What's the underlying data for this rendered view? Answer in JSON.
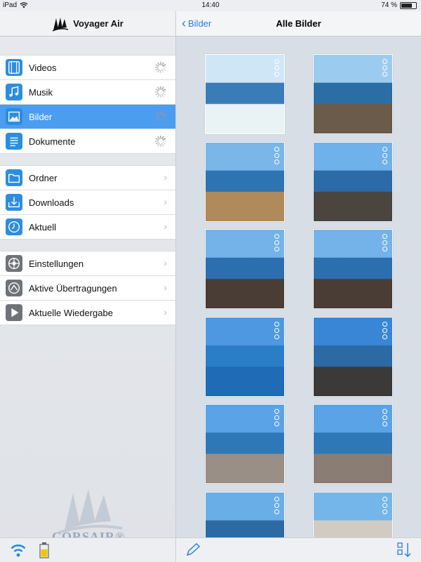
{
  "status": {
    "device": "iPad",
    "time": "14:40",
    "battery": "74 %",
    "battery_level": 0.74
  },
  "sidebar": {
    "app_title": "Voyager Air",
    "groups": [
      [
        {
          "label": "Videos",
          "icon": "film-icon",
          "trail": "spinner"
        },
        {
          "label": "Musik",
          "icon": "music-note-icon",
          "trail": "spinner"
        },
        {
          "label": "Bilder",
          "icon": "picture-icon",
          "trail": "spinner",
          "selected": true
        },
        {
          "label": "Dokumente",
          "icon": "document-icon",
          "trail": "spinner"
        }
      ],
      [
        {
          "label": "Ordner",
          "icon": "folder-icon",
          "trail": "chevron"
        },
        {
          "label": "Downloads",
          "icon": "download-icon",
          "trail": "chevron"
        },
        {
          "label": "Aktuell",
          "icon": "clock-icon",
          "trail": "chevron"
        }
      ],
      [
        {
          "label": "Einstellungen",
          "icon": "settings-icon",
          "trail": "chevron"
        },
        {
          "label": "Aktive Übertragungen",
          "icon": "transfer-icon",
          "trail": "chevron"
        },
        {
          "label": "Aktuelle Wiedergabe",
          "icon": "play-icon",
          "trail": "chevron"
        }
      ]
    ],
    "brand": "CORSAIR®"
  },
  "main": {
    "back_label": "Bilder",
    "title": "Alle Bilder",
    "photos": 12
  },
  "colors": {
    "accent": "#4b9df0",
    "link": "#2a7ae0"
  }
}
